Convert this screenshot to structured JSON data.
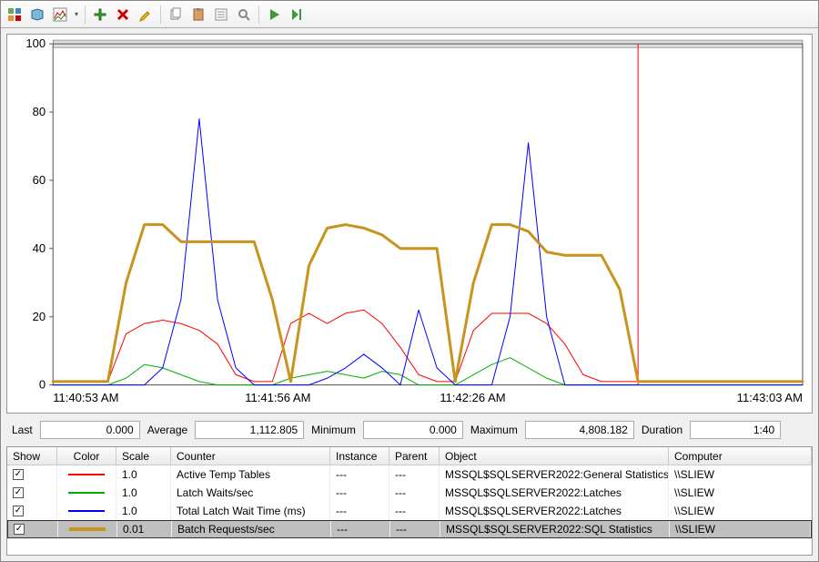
{
  "toolbar": {
    "icons": [
      "view-group",
      "new-set",
      "chart-view",
      "dropdown",
      "add",
      "remove",
      "highlight",
      "copy",
      "paste",
      "properties",
      "find",
      "play",
      "step"
    ]
  },
  "chart_data": {
    "type": "line",
    "ylim": [
      0,
      100
    ],
    "yticks": [
      0,
      20,
      40,
      60,
      80,
      100
    ],
    "x_labels": [
      "11:40:53 AM",
      "11:41:56 AM",
      "11:42:26 AM",
      "11:43:03 AM"
    ],
    "series": [
      {
        "name": "Active Temp Tables",
        "color": "#ff0000",
        "width": 1,
        "values": [
          1,
          1,
          1,
          1,
          15,
          18,
          19,
          18,
          16,
          12,
          3,
          1,
          1,
          18,
          21,
          18,
          21,
          22,
          18,
          11,
          3,
          1,
          1,
          16,
          21,
          21,
          21,
          18,
          12,
          3,
          1,
          1,
          1,
          1,
          1,
          1,
          1,
          1,
          1,
          1,
          1,
          1
        ]
      },
      {
        "name": "Latch Waits/sec",
        "color": "#00b000",
        "width": 1,
        "values": [
          0,
          0,
          0,
          0,
          2,
          6,
          5,
          3,
          1,
          0,
          0,
          0,
          0,
          2,
          3,
          4,
          3,
          2,
          4,
          3,
          0,
          0,
          0,
          3,
          6,
          8,
          5,
          2,
          0,
          0,
          0,
          0,
          0,
          0,
          0,
          0,
          0,
          0,
          0,
          0,
          0,
          0
        ]
      },
      {
        "name": "Total Latch Wait Time (ms)",
        "color": "#0000ff",
        "width": 1,
        "values": [
          0,
          0,
          0,
          0,
          0,
          0,
          5,
          25,
          78,
          25,
          5,
          0,
          0,
          0,
          0,
          2,
          5,
          9,
          5,
          0,
          22,
          5,
          0,
          0,
          0,
          20,
          71,
          20,
          0,
          0,
          0,
          0,
          0,
          0,
          0,
          0,
          0,
          0,
          0,
          0,
          0,
          0
        ]
      },
      {
        "name": "Batch Requests/sec",
        "color": "#c7941e",
        "width": 3,
        "values": [
          1,
          1,
          1,
          1,
          30,
          47,
          47,
          42,
          42,
          42,
          42,
          42,
          25,
          1,
          35,
          46,
          47,
          46,
          44,
          40,
          40,
          40,
          1,
          30,
          47,
          47,
          45,
          39,
          38,
          38,
          38,
          28,
          1,
          1,
          1,
          1,
          1,
          1,
          1,
          1,
          1,
          1
        ]
      }
    ],
    "now_marker_index": 32,
    "total_points": 42
  },
  "stats": {
    "last_label": "Last",
    "last": "0.000",
    "avg_label": "Average",
    "avg": "1,112.805",
    "min_label": "Minimum",
    "min": "0.000",
    "max_label": "Maximum",
    "max": "4,808.182",
    "dur_label": "Duration",
    "dur": "1:40"
  },
  "grid": {
    "headers": {
      "show": "Show",
      "color": "Color",
      "scale": "Scale",
      "counter": "Counter",
      "instance": "Instance",
      "parent": "Parent",
      "object": "Object",
      "computer": "Computer"
    },
    "rows": [
      {
        "checked": true,
        "color": "#ff0000",
        "thick": false,
        "scale": "1.0",
        "counter": "Active Temp Tables",
        "instance": "---",
        "parent": "---",
        "object": "MSSQL$SQLSERVER2022:General Statistics",
        "computer": "\\\\SLIEW",
        "selected": false
      },
      {
        "checked": true,
        "color": "#00b000",
        "thick": false,
        "scale": "1.0",
        "counter": "Latch Waits/sec",
        "instance": "---",
        "parent": "---",
        "object": "MSSQL$SQLSERVER2022:Latches",
        "computer": "\\\\SLIEW",
        "selected": false
      },
      {
        "checked": true,
        "color": "#0000ff",
        "thick": false,
        "scale": "1.0",
        "counter": "Total Latch Wait Time (ms)",
        "instance": "---",
        "parent": "---",
        "object": "MSSQL$SQLSERVER2022:Latches",
        "computer": "\\\\SLIEW",
        "selected": false
      },
      {
        "checked": true,
        "color": "#c7941e",
        "thick": true,
        "scale": "0.01",
        "counter": "Batch Requests/sec",
        "instance": "---",
        "parent": "---",
        "object": "MSSQL$SQLSERVER2022:SQL Statistics",
        "computer": "\\\\SLIEW",
        "selected": true
      }
    ]
  }
}
